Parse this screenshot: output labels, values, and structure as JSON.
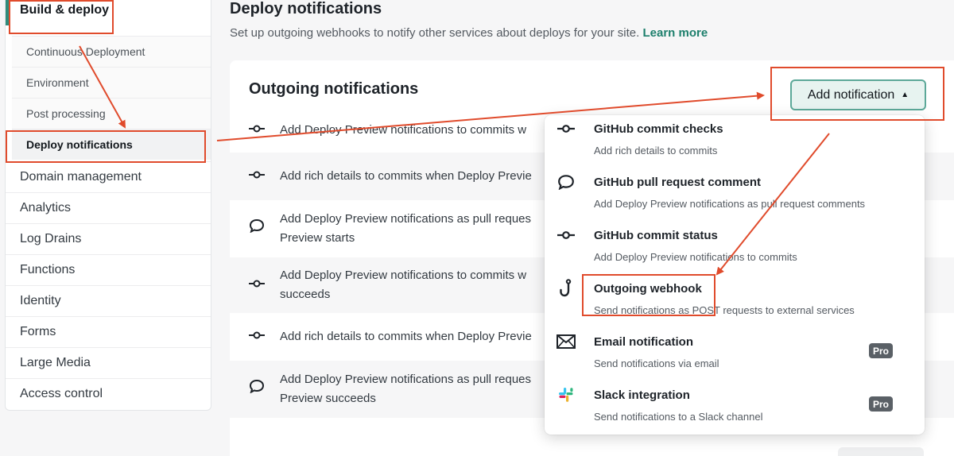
{
  "sidebar": {
    "section_active": "Build & deploy",
    "subitems": [
      "Continuous Deployment",
      "Environment",
      "Post processing",
      "Deploy notifications"
    ],
    "items": [
      "Domain management",
      "Analytics",
      "Log Drains",
      "Functions",
      "Identity",
      "Forms",
      "Large Media",
      "Access control"
    ]
  },
  "header": {
    "title": "Deploy notifications",
    "description": "Set up outgoing webhooks to notify other services about deploys for your site.",
    "learn_more": "Learn more"
  },
  "card": {
    "title": "Outgoing notifications",
    "add_button": "Add notification",
    "rows": [
      {
        "icon": "commit-icon",
        "line1": "Add Deploy Preview notifications to commits w",
        "line2": ""
      },
      {
        "icon": "commit-icon",
        "line1": "Add rich details to commits when Deploy Previe",
        "line2": ""
      },
      {
        "icon": "comment-icon",
        "line1": "Add Deploy Preview notifications as pull reques",
        "line2": "Preview starts"
      },
      {
        "icon": "commit-icon",
        "line1": "Add Deploy Preview notifications to commits w",
        "line2": "succeeds"
      },
      {
        "icon": "commit-icon",
        "line1": "Add rich details to commits when Deploy Previe",
        "line2": ""
      },
      {
        "icon": "comment-icon",
        "line1": "Add Deploy Preview notifications as pull reques",
        "line2": "Preview succeeds"
      }
    ]
  },
  "menu": {
    "items": [
      {
        "icon": "commit-icon",
        "title": "GitHub commit checks",
        "desc": "Add rich details to commits",
        "badge": ""
      },
      {
        "icon": "comment-icon",
        "title": "GitHub pull request comment",
        "desc": "Add Deploy Preview notifications as pull request comments",
        "badge": ""
      },
      {
        "icon": "commit-icon",
        "title": "GitHub commit status",
        "desc": "Add Deploy Preview notifications to commits",
        "badge": ""
      },
      {
        "icon": "webhook-icon",
        "title": "Outgoing webhook",
        "desc": "Send notifications as POST requests to external services",
        "badge": ""
      },
      {
        "icon": "envelope-icon",
        "title": "Email notification",
        "desc": "Send notifications via email",
        "badge": "Pro"
      },
      {
        "icon": "slack-icon",
        "title": "Slack integration",
        "desc": "Send notifications to a Slack channel",
        "badge": "Pro"
      }
    ]
  },
  "colors": {
    "accent": "#1d7f6c",
    "annotation": "#e04b2c",
    "pro_badge": "#5a6066"
  }
}
